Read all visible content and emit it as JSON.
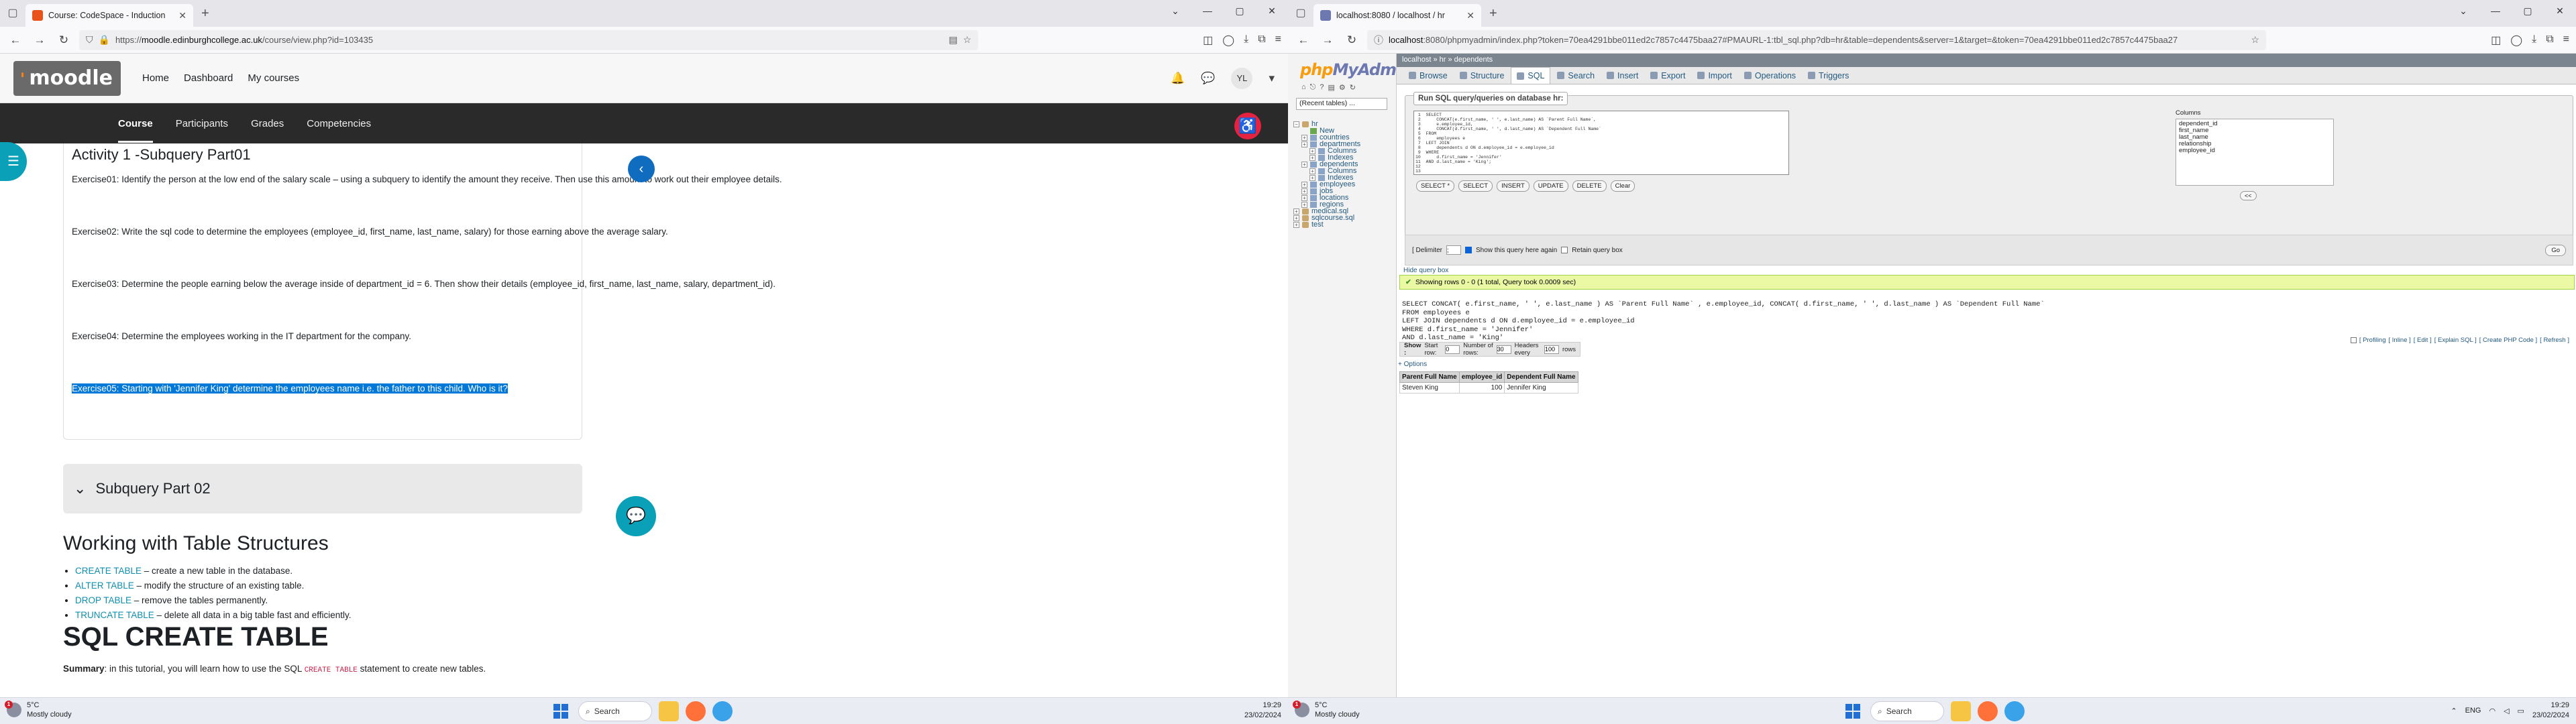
{
  "left": {
    "tab_title": "Course: CodeSpace - Induction",
    "url_host": "moodle.edinburghcollege.ac.uk",
    "url_rest": "/course/view.php?id=103435",
    "url_prefix": "https://",
    "moodle_nav": [
      "Home",
      "Dashboard",
      "My courses"
    ],
    "avatar": "YL",
    "subnav": [
      "Course",
      "Participants",
      "Grades",
      "Competencies"
    ],
    "activity_title": "Activity 1 -Subquery Part01",
    "exercises": [
      "Exercise01: Identify the person at the low end of the salary scale – using a subquery to identify the amount they receive. Then use this amount to work out their employee details.",
      "Exercise02: Write the sql code to determine the employees (employee_id, first_name, last_name, salary) for those earning above the average salary.",
      "Exercise03: Determine the people earning below the average inside of department_id = 6. Then show their details (employee_id, first_name, last_name, salary, department_id).",
      "Exercise04: Determine the employees working in the IT department for the company.",
      "Exercise05: Starting with 'Jennifer King' determine the employees name i.e. the father to this child. Who is it?"
    ],
    "section2": "Subquery Part 02",
    "heading_tables": "Working with Table Structures",
    "bullets": [
      {
        "kw": "CREATE TABLE",
        "rest": " – create a new table in the database."
      },
      {
        "kw": "ALTER TABLE",
        "rest": " – modify the structure of an existing table."
      },
      {
        "kw": "DROP TABLE",
        "rest": " – remove the tables permanently."
      },
      {
        "kw": "TRUNCATE TABLE",
        "rest": " – delete all data in a big table fast and efficiently."
      }
    ],
    "heading_create": "SQL CREATE TABLE",
    "summary_label": "Summary",
    "summary_text_a": ": in this tutorial, you will learn how to use the SQL ",
    "summary_code": "CREATE TABLE",
    "summary_text_b": " statement to create new tables.",
    "weather_temp": "5°C",
    "weather_desc": "Mostly cloudy",
    "search_label": "Search",
    "time": "19:29",
    "date": "23/02/2024"
  },
  "right": {
    "tab_title": "localhost:8080 / localhost / hr",
    "url_host": "localhost",
    "url_rest": ":8080/phpmyadmin/index.php?token=70ea4291bbe011ed2c7857c4475baa27#PMAURL-1:tbl_sql.php?db=hr&table=dependents&server=1&target=&token=70ea4291bbe011ed2c7857c4475baa27",
    "logo_a": "php",
    "logo_b": "MyAdmin",
    "recent_tables": "(Recent tables) ...",
    "tree": [
      {
        "label": "hr",
        "level": 0,
        "kind": "db"
      },
      {
        "label": "New",
        "level": 1,
        "kind": "new"
      },
      {
        "label": "countries",
        "level": 1,
        "kind": "tbl"
      },
      {
        "label": "departments",
        "level": 1,
        "kind": "tbl"
      },
      {
        "label": "Columns",
        "level": 2,
        "kind": "tbl"
      },
      {
        "label": "Indexes",
        "level": 2,
        "kind": "tbl"
      },
      {
        "label": "dependents",
        "level": 1,
        "kind": "tbl"
      },
      {
        "label": "Columns",
        "level": 2,
        "kind": "tbl"
      },
      {
        "label": "Indexes",
        "level": 2,
        "kind": "tbl"
      },
      {
        "label": "employees",
        "level": 1,
        "kind": "tbl"
      },
      {
        "label": "jobs",
        "level": 1,
        "kind": "tbl"
      },
      {
        "label": "locations",
        "level": 1,
        "kind": "tbl"
      },
      {
        "label": "regions",
        "level": 1,
        "kind": "tbl"
      },
      {
        "label": "medical.sql",
        "level": 0,
        "kind": "db"
      },
      {
        "label": "sqlcourse.sql",
        "level": 0,
        "kind": "db"
      },
      {
        "label": "test",
        "level": 0,
        "kind": "db"
      }
    ],
    "breadcrumb": "localhost » hr » dependents",
    "tabs": [
      "Browse",
      "Structure",
      "SQL",
      "Search",
      "Insert",
      "Export",
      "Import",
      "Operations",
      "Triggers"
    ],
    "active_tab": "SQL",
    "legend": "Run SQL query/queries on database hr:",
    "editor_lines": [
      "SELECT",
      "    CONCAT(e.first_name, ' ', e.last_name) AS `Parent Full Name`,",
      "    e.employee_id,",
      "    CONCAT(d.first_name, ' ', d.last_name) AS `Dependent Full Name`",
      "FROM",
      "    employees e",
      "LEFT JOIN",
      "    dependents d ON d.employee_id = e.employee_id",
      "WHERE",
      "    d.first_name = 'Jennifer'",
      "AND d.last_name = 'King';",
      "",
      ""
    ],
    "editor_buttons": [
      "SELECT *",
      "SELECT",
      "INSERT",
      "UPDATE",
      "DELETE",
      "Clear"
    ],
    "columns_label": "Columns",
    "columns": [
      "dependent_id",
      "first_name",
      "last_name",
      "relationship",
      "employee_id"
    ],
    "insert_btn": "<<",
    "delimiter_label": "[ Delimiter",
    "delimiter_value": ";",
    "show_again": "Show this query here again",
    "retain": "Retain query box",
    "go": "Go",
    "hide_query": "Hide query box",
    "success": "Showing rows 0 - 0 (1 total, Query took 0.0009 sec)",
    "sql_lines": [
      "SELECT CONCAT( e.first_name, ' ', e.last_name ) AS `Parent Full Name` , e.employee_id, CONCAT( d.first_name, ' ', d.last_name ) AS `Dependent Full Name`",
      "FROM employees e",
      "LEFT JOIN dependents d ON d.employee_id = e.employee_id",
      "WHERE d.first_name = 'Jennifer'",
      "AND d.last_name = 'King'",
      "LIMIT 0 , 30"
    ],
    "sql_tools": [
      "[ Profiling",
      "[ Inline ]",
      "[ Edit ]",
      "[ Explain SQL ]",
      "[ Create PHP Code ]",
      "[ Refresh ]"
    ],
    "show_label": "Show :",
    "start_row_label": "Start row:",
    "start_row": "0",
    "num_rows_label": "Number of rows:",
    "num_rows": "30",
    "headers_label": "Headers every",
    "headers_every": "100",
    "rows_label": "rows",
    "options": "+ Options",
    "result_headers": [
      "Parent Full Name",
      "employee_id",
      "Dependent Full Name"
    ],
    "result_rows": [
      [
        "Steven King",
        "100",
        "Jennifer King"
      ]
    ],
    "time": "19:29",
    "date": "23/02/2024",
    "lang": "ENG"
  }
}
